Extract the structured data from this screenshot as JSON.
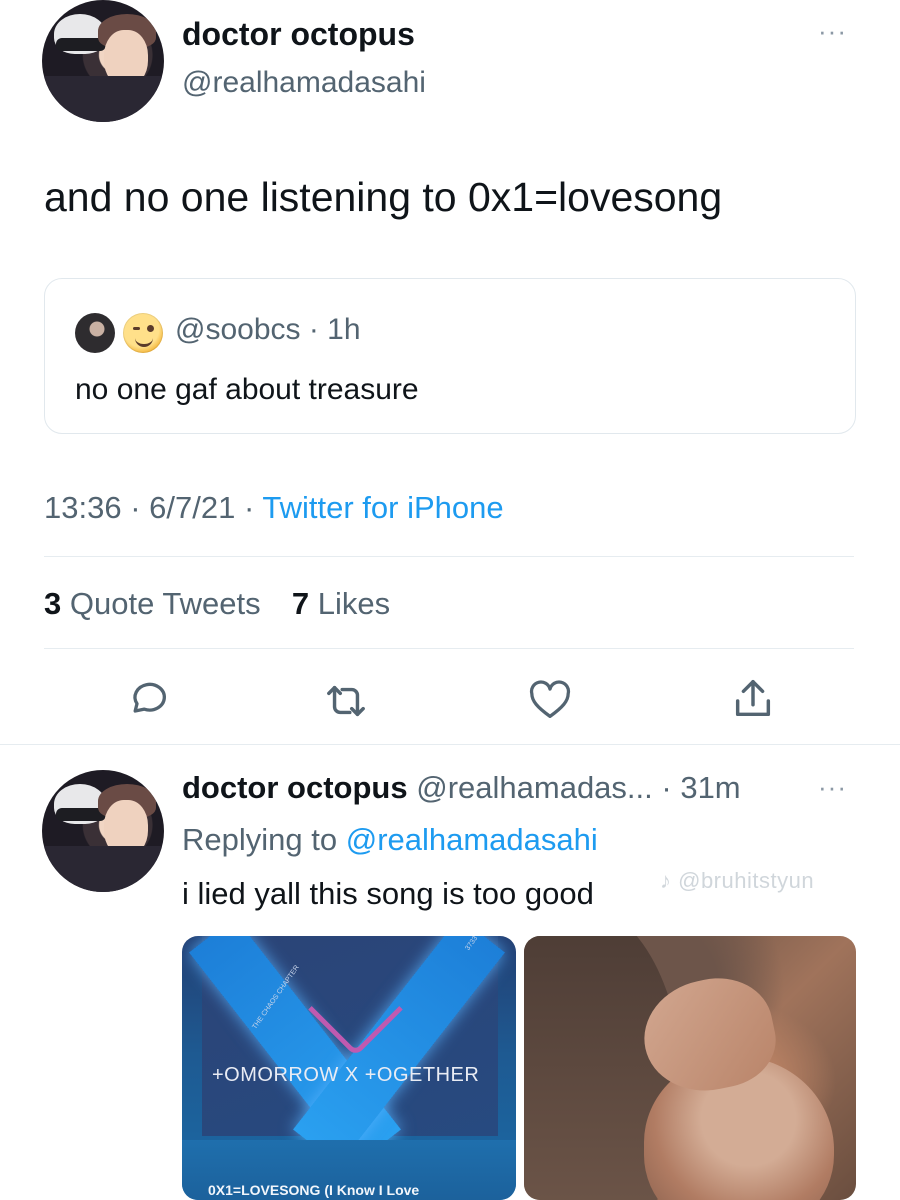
{
  "tweet": {
    "display_name": "doctor octopus",
    "handle": "@realhamadasahi",
    "more": "···",
    "text": "and no one listening to 0x1=lovesong",
    "quote": {
      "handle": "@soobcs",
      "time": "· 1h",
      "text": "no one gaf about treasure"
    },
    "time": "13:36",
    "date": "6/7/21",
    "source": "Twitter for iPhone",
    "separator": "·",
    "stats": {
      "quote_count": "3",
      "quote_label": "Quote Tweets",
      "like_count": "7",
      "like_label": "Likes"
    }
  },
  "actions": {
    "reply_icon": "reply-icon",
    "retweet_icon": "retweet-icon",
    "like_icon": "heart-icon",
    "share_icon": "share-icon"
  },
  "reply": {
    "display_name": "doctor octopus",
    "handle": "@realhamadas...",
    "time": "· 31m",
    "more": "···",
    "replying_prefix": "Replying to",
    "replying_to": "@realhamadasahi",
    "text": "i lied yall this song is too good",
    "watermark": "♪ @bruhitstyun",
    "media": {
      "album": {
        "group": "+OMORROW X +OGETHER",
        "chapter": "THE CHAOS CHAPTER",
        "code": "3733",
        "song": "0X1=LOVESONG (I Know I Love"
      }
    }
  },
  "colors": {
    "link": "#1d9bf0",
    "muted": "#536471",
    "text": "#0f1419",
    "divider": "#e6ecf0"
  }
}
